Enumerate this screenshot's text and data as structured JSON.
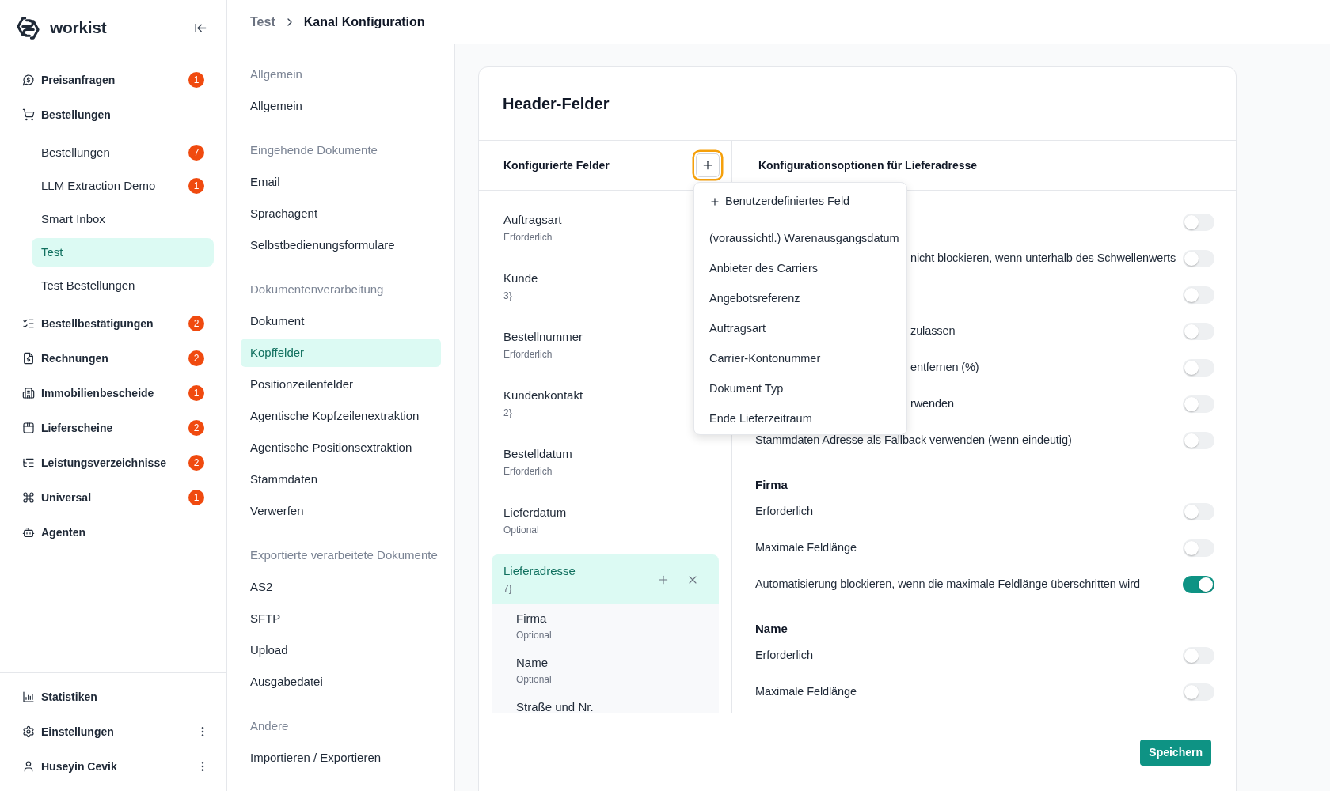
{
  "sidebar": {
    "brand": "workist",
    "items": [
      {
        "label": "Preisanfragen",
        "badge": "1",
        "selected": false
      },
      {
        "label": "Bestellungen",
        "selected": false,
        "children": [
          {
            "label": "Bestellungen",
            "badge": "7",
            "selected": false
          },
          {
            "label": "LLM Extraction Demo",
            "badge": "1",
            "selected": false
          },
          {
            "label": "Smart Inbox",
            "selected": false
          },
          {
            "label": "Test",
            "selected": true
          },
          {
            "label": "Test Bestellungen",
            "selected": false
          }
        ]
      },
      {
        "label": "Bestellbestätigungen",
        "badge": "2",
        "selected": false
      },
      {
        "label": "Rechnungen",
        "badge": "2",
        "selected": false
      },
      {
        "label": "Immobilienbescheide",
        "badge": "1",
        "selected": false
      },
      {
        "label": "Lieferscheine",
        "badge": "2",
        "selected": false
      },
      {
        "label": "Leistungsverzeichnisse",
        "badge": "2",
        "selected": false
      },
      {
        "label": "Universal",
        "badge": "1",
        "selected": false
      },
      {
        "label": "Agenten",
        "selected": false
      }
    ],
    "footer_items": [
      {
        "label": "Statistiken",
        "menu": false
      },
      {
        "label": "Einstellungen",
        "menu": true
      },
      {
        "label": "Huseyin Cevik",
        "menu": true
      }
    ]
  },
  "breadcrumb": [
    {
      "label": "Test",
      "current": false
    },
    {
      "label": "Kanal Konfiguration",
      "current": true
    }
  ],
  "settings_nav": {
    "sections": [
      {
        "title": "Allgemein",
        "items": [
          {
            "label": "Allgemein",
            "selected": false
          }
        ]
      },
      {
        "title": "Eingehende Dokumente",
        "items": [
          {
            "label": "Email",
            "selected": false
          },
          {
            "label": "Sprachagent",
            "selected": false
          },
          {
            "label": "Selbstbedienungsformulare",
            "selected": false
          }
        ]
      },
      {
        "title": "Dokumentenverarbeitung",
        "items": [
          {
            "label": "Dokument",
            "selected": false
          },
          {
            "label": "Kopffelder",
            "selected": true
          },
          {
            "label": "Positionzeilenfelder",
            "selected": false
          },
          {
            "label": "Agentische Kopfzeilenextraktion",
            "selected": false
          },
          {
            "label": "Agentische Positionsextraktion",
            "selected": false
          },
          {
            "label": "Stammdaten",
            "selected": false
          },
          {
            "label": "Verwerfen",
            "selected": false
          }
        ]
      },
      {
        "title": "Exportierte verarbeitete Dokumente",
        "items": [
          {
            "label": "AS2",
            "selected": false
          },
          {
            "label": "SFTP",
            "selected": false
          },
          {
            "label": "Upload",
            "selected": false
          },
          {
            "label": "Ausgabedatei",
            "selected": false
          }
        ]
      },
      {
        "title": "Andere",
        "items": [
          {
            "label": "Importieren / Exportieren",
            "selected": false
          }
        ]
      }
    ]
  },
  "card": {
    "title": "Header-Felder",
    "fields_panel": {
      "title": "Konfigurierte Felder",
      "add_button": {
        "focused": true
      },
      "add_menu": {
        "open": true,
        "items": [
          {
            "kind": "custom",
            "label": "Benutzerdefiniertes Feld"
          },
          {
            "kind": "field",
            "label": "(voraussichtl.) Warenausgangsdatum"
          },
          {
            "kind": "field",
            "label": "Anbieter des Carriers"
          },
          {
            "kind": "field",
            "label": "Angebotsreferenz"
          },
          {
            "kind": "field",
            "label": "Auftragsart"
          },
          {
            "kind": "field",
            "label": "Carrier-Kontonummer"
          },
          {
            "kind": "field",
            "label": "Dokument Typ"
          },
          {
            "kind": "field",
            "label": "Ende Lieferzeitraum"
          }
        ]
      },
      "fields": [
        {
          "name": "Auftragsart",
          "status": "Erforderlich",
          "selected": false
        },
        {
          "name": "Kunde",
          "status": "3}",
          "selected": false
        },
        {
          "name": "Bestellnummer",
          "status": "Erforderlich",
          "selected": false
        },
        {
          "name": "Kundenkontakt",
          "status": "2}",
          "selected": false
        },
        {
          "name": "Bestelldatum",
          "status": "Erforderlich",
          "selected": false
        },
        {
          "name": "Lieferdatum",
          "status": "Optional",
          "selected": false
        },
        {
          "name": "Lieferadresse",
          "status": "7}",
          "selected": true,
          "children": [
            {
              "name": "Firma",
              "status": "Optional"
            },
            {
              "name": "Name",
              "status": "Optional"
            },
            {
              "name": "Straße und Nr."
            }
          ]
        }
      ]
    },
    "options_panel": {
      "title": "Konfigurationsoptionen für Lieferadresse",
      "rows": [
        {
          "kind": "toggle",
          "on": false
        },
        {
          "kind": "clipped",
          "label": "nicht blockieren, wenn unterhalb des Schwellenwerts",
          "on": false
        },
        {
          "kind": "toggle",
          "on": false
        },
        {
          "kind": "clipped",
          "label": "zulassen",
          "on": false
        },
        {
          "kind": "clipped",
          "label": "entfernen (%)",
          "on": false
        },
        {
          "kind": "clipped",
          "label": "rwenden",
          "on": false
        },
        {
          "kind": "toggle",
          "label": "Stammdaten Adresse als Fallback verwenden (wenn eindeutig)",
          "on": false
        },
        {
          "kind": "heading",
          "label": "Firma"
        },
        {
          "kind": "toggle",
          "label": "Erforderlich",
          "on": false
        },
        {
          "kind": "toggle",
          "label": "Maximale Feldlänge",
          "on": false
        },
        {
          "kind": "toggle",
          "label": "Automatisierung blockieren, wenn die maximale Feldlänge überschritten wird",
          "on": true
        },
        {
          "kind": "heading",
          "label": "Name"
        },
        {
          "kind": "toggle",
          "label": "Erforderlich",
          "on": false
        },
        {
          "kind": "toggle",
          "label": "Maximale Feldlänge",
          "on": false
        }
      ]
    },
    "save_button": {
      "label": "Speichern"
    }
  }
}
